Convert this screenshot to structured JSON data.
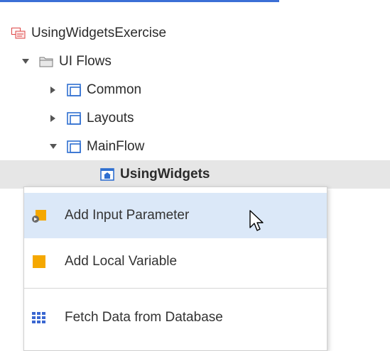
{
  "tree": {
    "root": {
      "label": "UsingWidgetsExercise",
      "icon": "module-icon"
    },
    "ui_flows": {
      "label": "UI Flows",
      "icon": "folder-icon"
    },
    "flows": [
      {
        "label": "Common",
        "icon": "flow-icon",
        "expanded": false
      },
      {
        "label": "Layouts",
        "icon": "flow-icon",
        "expanded": false
      },
      {
        "label": "MainFlow",
        "icon": "flow-icon",
        "expanded": true
      }
    ],
    "screen": {
      "label": "UsingWidgets",
      "icon": "home-screen-icon",
      "selected": true
    }
  },
  "context_menu": {
    "items": [
      {
        "label": "Add Input Parameter",
        "icon": "input-parameter-icon",
        "hovered": true
      },
      {
        "label": "Add Local Variable",
        "icon": "local-variable-icon"
      },
      {
        "label": "Fetch Data from Database",
        "icon": "aggregate-icon"
      }
    ]
  },
  "colors": {
    "accent": "#3b6fd6",
    "selection": "#e6e6e6",
    "hover": "#dbe8f8",
    "variable": "#f5a800",
    "flow_icon": "#2f6fd0"
  }
}
